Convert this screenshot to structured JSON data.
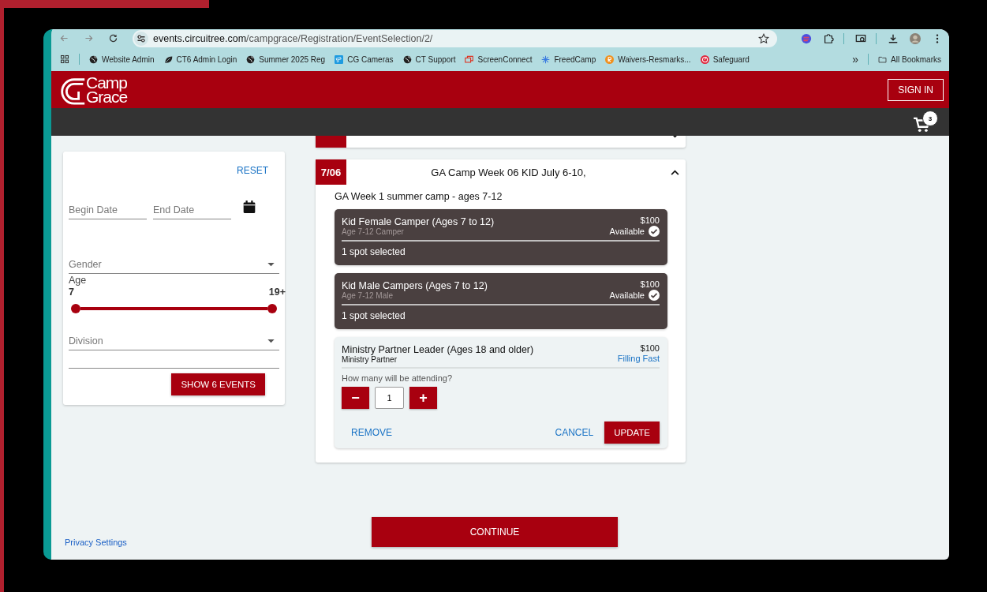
{
  "browser": {
    "url_domain": "events.circuitree.com",
    "url_path": "/campgrace/Registration/EventSelection/2/",
    "bookmarks": [
      {
        "label": "Website Admin",
        "kind": "globe"
      },
      {
        "label": "CT6 Admin Login",
        "kind": "leaf"
      },
      {
        "label": "Summer 2025 Reg",
        "kind": "globe"
      },
      {
        "label": "CG Cameras",
        "kind": "camera"
      },
      {
        "label": "CT Support",
        "kind": "globe"
      },
      {
        "label": "ScreenConnect",
        "kind": "screens"
      },
      {
        "label": "FreedCamp",
        "kind": "grid"
      },
      {
        "label": "Waivers-Resmarks...",
        "kind": "orange"
      },
      {
        "label": "Safeguard",
        "kind": "red"
      }
    ],
    "more": "»",
    "all_bookmarks": "All Bookmarks"
  },
  "header": {
    "logo_lines": [
      "Camp",
      "Grace"
    ],
    "sign_in": "SIGN IN",
    "cart_count": "3"
  },
  "filters": {
    "reset": "RESET",
    "begin_date": {
      "placeholder": "Begin Date"
    },
    "end_date": {
      "placeholder": "End Date"
    },
    "gender": {
      "placeholder": "Gender"
    },
    "age": {
      "label": "Age",
      "thumbs": [
        {
          "label": "7",
          "level": 0
        },
        {
          "label": "19+",
          "level": 1
        }
      ]
    },
    "division": {
      "placeholder": "Division"
    },
    "show_button": "SHOW 6 EVENTS"
  },
  "events": [
    {
      "expanded": false
    },
    {
      "date": "7/06",
      "title": "GA Camp Week 06 KID July 6-10,",
      "expanded": true,
      "description": "GA Week 1 summer camp - ages 7-12",
      "tickets": [
        {
          "name": "Kid Female Camper (Ages 7 to 12)",
          "subtitle": "Age 7-12 Camper",
          "price": "$100",
          "status": {
            "text": "Available",
            "kind": "available"
          },
          "selected": true,
          "selection": "1 spot selected"
        },
        {
          "name": "Kid Male Campers (Ages 7 to 12)",
          "subtitle": "Age 7-12 Male",
          "price": "$100",
          "status": {
            "text": "Available",
            "kind": "available"
          },
          "selected": true,
          "selection": "1 spot selected"
        },
        {
          "name": "Ministry Partner Leader (Ages 18 and older)",
          "subtitle": "Ministry Partner",
          "price": "$100",
          "status": {
            "text": "Filling Fast",
            "kind": "filling"
          },
          "selected": false,
          "editor": {
            "question": "How many will be attending?",
            "minus": "−",
            "quantity": {
              "value": "1"
            },
            "plus": "+",
            "remove": "REMOVE",
            "cancel": "CANCEL",
            "update": "UPDATE"
          }
        }
      ]
    }
  ],
  "footer": {
    "privacy": "Privacy Settings",
    "continue": "CONTINUE"
  }
}
